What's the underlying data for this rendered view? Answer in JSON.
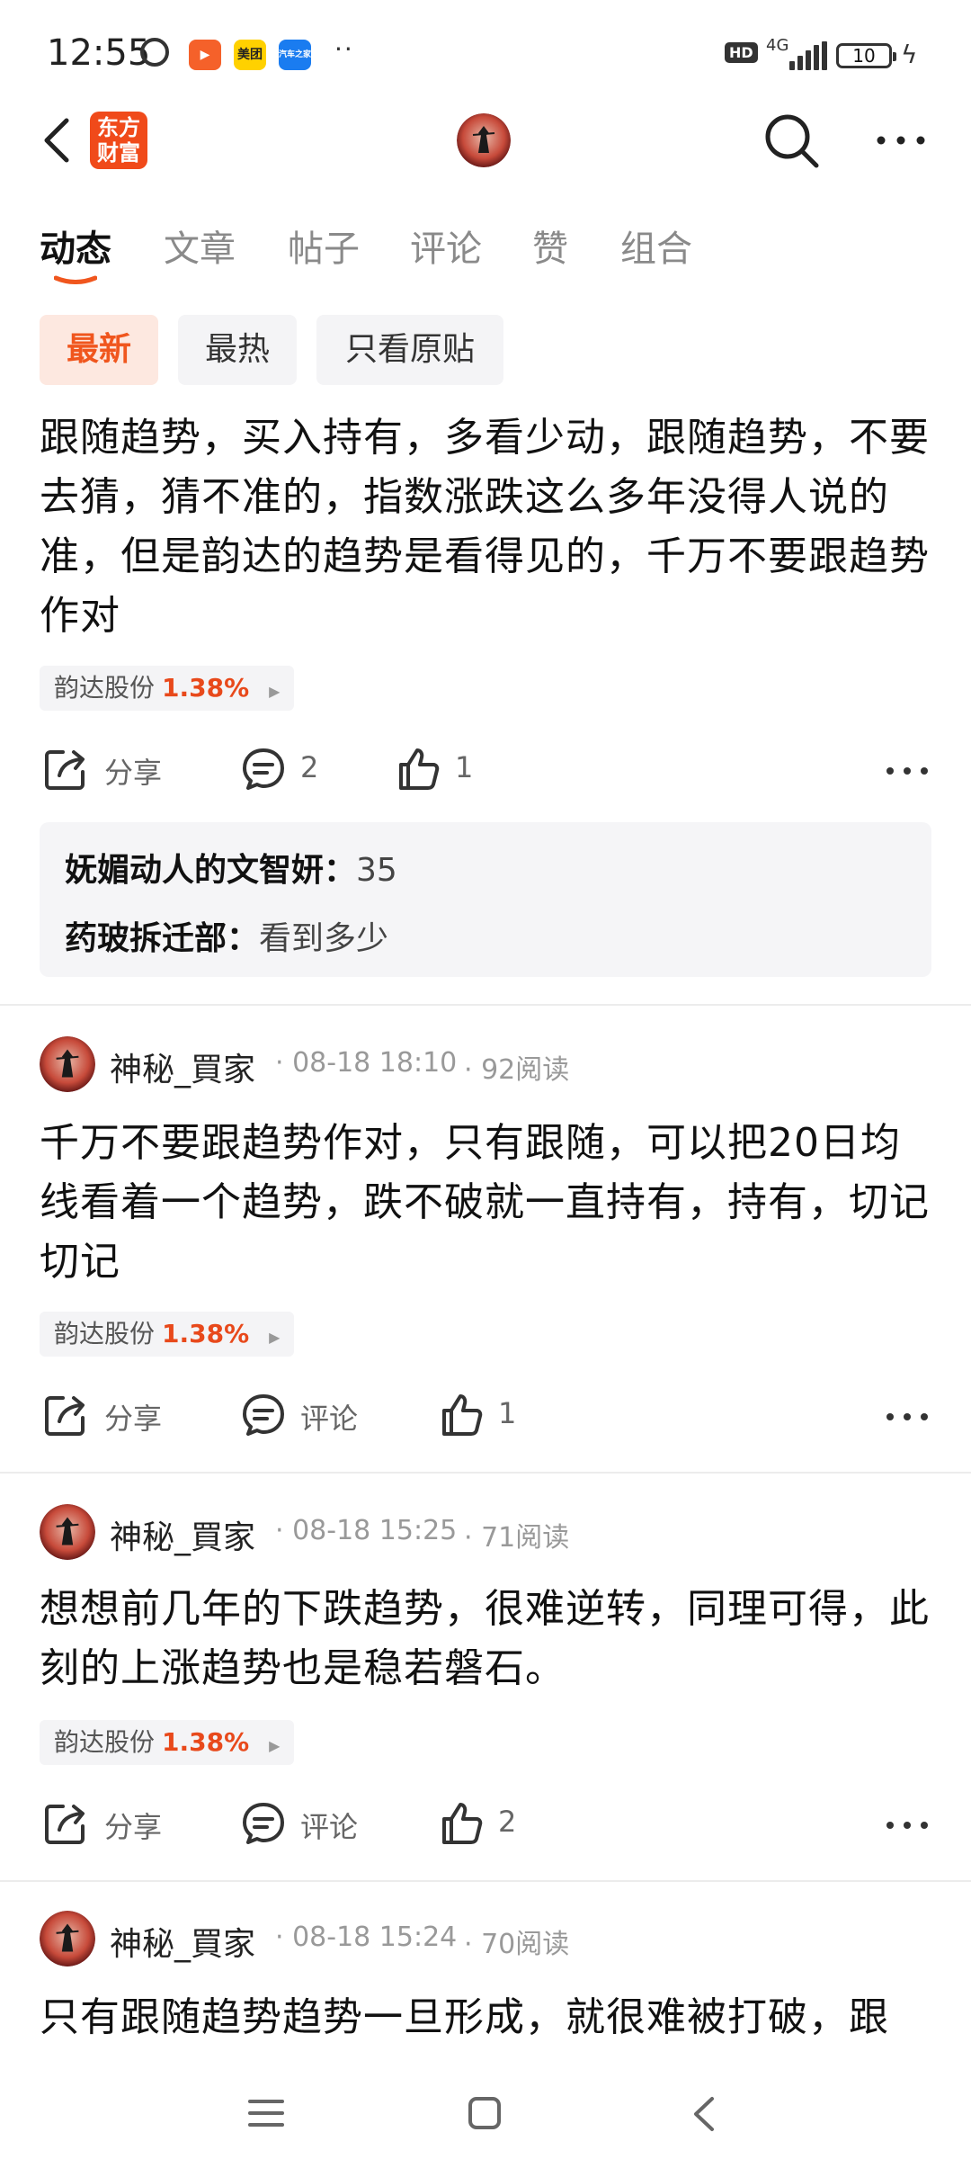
{
  "status_bar": {
    "time": "12:55",
    "battery": "10",
    "network": "4G",
    "hd": "HD",
    "app1": "美团",
    "app2": "汽车之家"
  },
  "header": {
    "logo_text": "东方财富"
  },
  "tabs": [
    {
      "label": "动态",
      "active": true
    },
    {
      "label": "文章"
    },
    {
      "label": "帖子"
    },
    {
      "label": "评论"
    },
    {
      "label": "赞"
    },
    {
      "label": "组合"
    }
  ],
  "filters": [
    "最新",
    "最热",
    "只看原贴"
  ],
  "posts": [
    {
      "text": "跟随趋势，买入持有，多看少动，跟随趋势，不要去猜，猜不准的，指数涨跌这么多年没得人说的准，但是韵达的趋势是看得见的，千万不要跟趋势作对",
      "stock_name": "韵达股份",
      "stock_pct": "1.38%",
      "share_label": "分享",
      "comment_label": "2",
      "like_count": "1",
      "replies": [
        {
          "user": "妩媚动人的文智妍",
          "text": "35"
        },
        {
          "user": "药玻拆迁部",
          "text": "看到多少"
        }
      ]
    },
    {
      "user": "神秘_買家",
      "date": "08-18 18:10",
      "reads": "92阅读",
      "text": "千万不要跟趋势作对，只有跟随，可以把20日均线看着一个趋势，跌不破就一直持有，持有，切记切记",
      "stock_name": "韵达股份",
      "stock_pct": "1.38%",
      "share_label": "分享",
      "comment_label": "评论",
      "like_count": "1"
    },
    {
      "user": "神秘_買家",
      "date": "08-18 15:25",
      "reads": "71阅读",
      "text": "想想前几年的下跌趋势，很难逆转，同理可得，此刻的上涨趋势也是稳若磐石。",
      "stock_name": "韵达股份",
      "stock_pct": "1.38%",
      "share_label": "分享",
      "comment_label": "评论",
      "like_count": "2"
    },
    {
      "user": "神秘_買家",
      "date": "08-18 15:24",
      "reads": "70阅读",
      "text": "只有跟随趋势趋势一旦形成，就很难被打破，跟"
    }
  ],
  "colors": {
    "accent": "#f0561e",
    "stock_up": "#e8491b",
    "logo_bg": "#f04a1a"
  }
}
